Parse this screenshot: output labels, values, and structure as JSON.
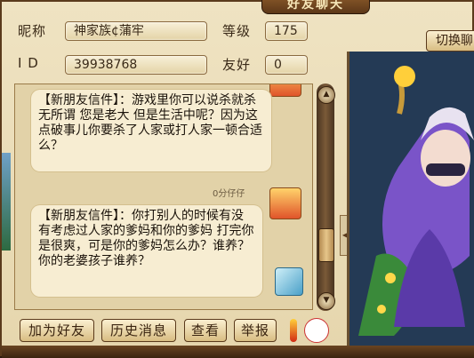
{
  "window": {
    "title": "好友聊天"
  },
  "profile": {
    "nickname_label": "昵称",
    "nickname_value": "神家族¢蒲牢",
    "level_label": "等级",
    "level_value": "175",
    "id_label": "I D",
    "id_value": "39938768",
    "friendship_label": "友好",
    "friendship_value": "0"
  },
  "messages": [
    {
      "text": "【新朋友信件】：游戏里你可以说杀就杀无所谓 您是老大 但是生活中呢？因为这点破事儿你要杀了人家或打人家一顿合适么？"
    },
    {
      "timestamp": "0分仔仔"
    },
    {
      "text": "【新朋友信件】：你打别人的时候有没有考虑过人家的爹妈和你的爹妈 打完你是很爽，可是你的爹妈怎么办？谁养？你的老婆孩子谁养？"
    }
  ],
  "buttons": {
    "add_friend": "加为好友",
    "history": "历史消息",
    "view": "查看",
    "report": "举报",
    "switch": "切换聊"
  },
  "colors": {
    "frame_bg": "#efe3c2",
    "border": "#5a3a1c",
    "text": "#3a2a18"
  }
}
